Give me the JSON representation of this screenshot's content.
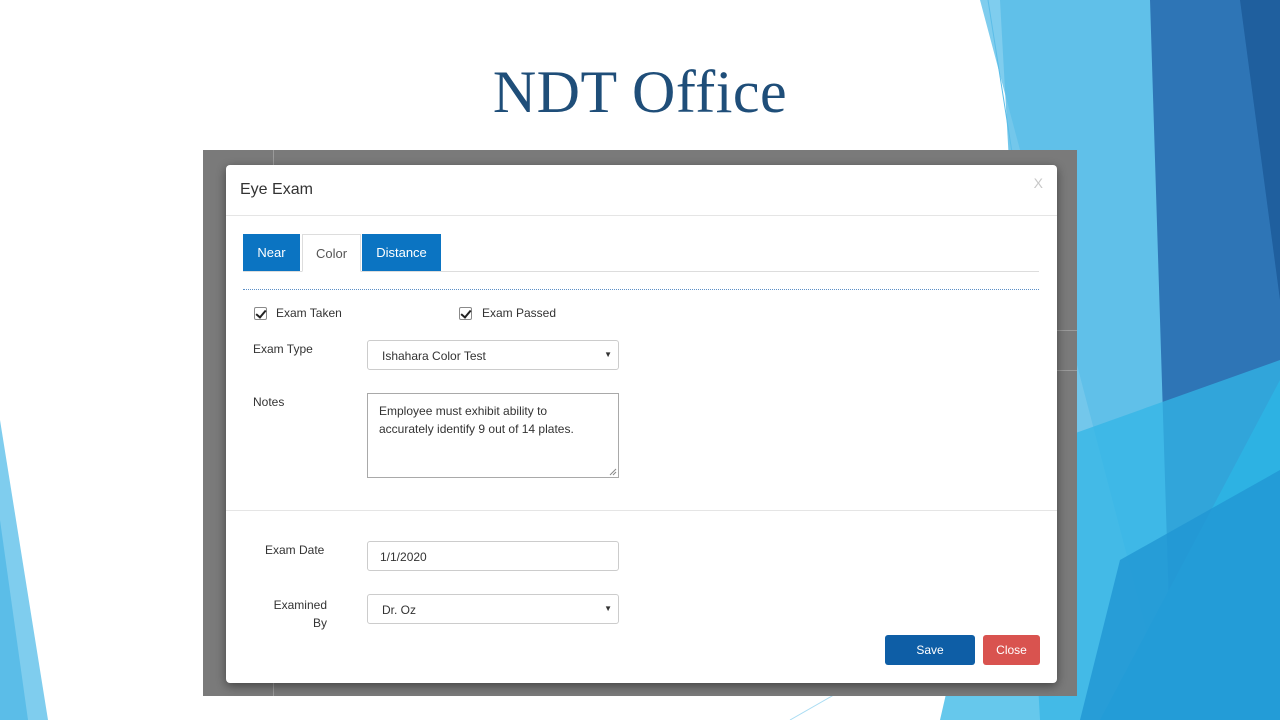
{
  "slide": {
    "title": "NDT Office"
  },
  "modal": {
    "title": "Eye Exam",
    "close_glyph": "X",
    "tabs": [
      {
        "label": "Near",
        "state": "highlighted"
      },
      {
        "label": "Color",
        "state": "active"
      },
      {
        "label": "Distance",
        "state": "highlighted"
      }
    ],
    "exam_taken": {
      "label": "Exam Taken",
      "checked": true
    },
    "exam_passed": {
      "label": "Exam Passed",
      "checked": true
    },
    "exam_type": {
      "label": "Exam Type",
      "value": "Ishahara Color Test"
    },
    "notes": {
      "label": "Notes",
      "value": "Employee must exhibit ability to accurately identify 9 out of 14 plates."
    },
    "exam_date": {
      "label": "Exam Date",
      "value": "1/1/2020"
    },
    "examined_by": {
      "label_line1": "Examined",
      "label_line2": "By",
      "value": "Dr. Oz"
    },
    "buttons": {
      "save": "Save",
      "close": "Close"
    }
  },
  "colors": {
    "title": "#1f4e79",
    "tab_blue": "#0b74c2",
    "save": "#0e5ea6",
    "close": "#d9534f"
  }
}
